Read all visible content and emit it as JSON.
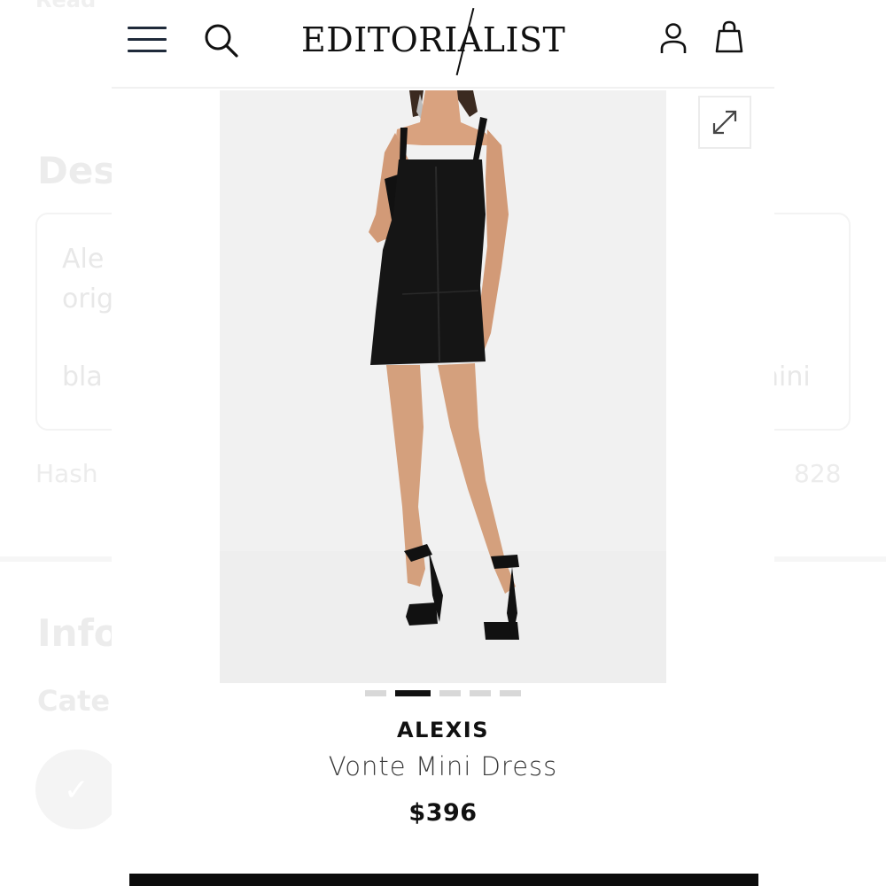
{
  "background": {
    "top_fragment": "Read",
    "heading_fragment": "Des",
    "desc_line1": "Ale",
    "desc_line2": "orig",
    "desc_line3_left": "bla",
    "desc_line3_right": "nini",
    "hash_left": "Hash",
    "hash_right": "828",
    "info_fragment": "Info",
    "category_fragment": "Cate"
  },
  "header": {
    "logo": "EDITORIALIST",
    "menu_icon": "hamburger-menu-icon",
    "search_icon": "search-icon",
    "account_icon": "user-account-icon",
    "bag_icon": "shopping-bag-icon"
  },
  "gallery": {
    "image_alt": "Model wearing black square-neck mini dress with black strappy heels",
    "expand_icon": "expand-diagonal-icon",
    "slide_count": 5,
    "active_slide": 2
  },
  "product": {
    "brand": "ALEXIS",
    "name": "Vonte Mini Dress",
    "price": "$396"
  },
  "colors": {
    "accent": "#111111",
    "panel_bg": "#ffffff",
    "image_bg": "#f1f1f1"
  }
}
